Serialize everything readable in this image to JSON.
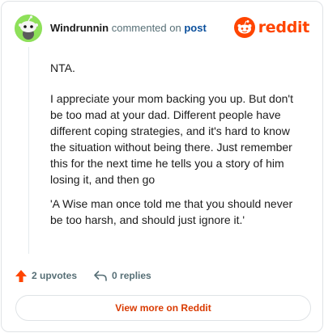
{
  "header": {
    "username": "Windrunnin",
    "action_text": "commented on",
    "post_link": "post",
    "brand": "reddit"
  },
  "comment": {
    "paragraphs": [
      "NTA.",
      "I appreciate your mom backing you up. But don't be too mad at your dad. Different people have different coping strategies, and it's hard to know the situation without being there. Just remember this for the next time he tells you a story of him losing it, and then go",
      "'A Wise man once told me that you should never be too harsh, and should just ignore it.'"
    ]
  },
  "actions": {
    "upvotes": "2 upvotes",
    "replies": "0 replies"
  },
  "footer": {
    "view_more": "View more on Reddit"
  },
  "colors": {
    "brand": "#ff4500",
    "link": "#0a4f9c",
    "upvote": "#ff4500",
    "view_more": "#d93a00",
    "avatar_bg": "#8ee05a"
  },
  "icons": {
    "avatar": "snoo-avatar-icon",
    "brand": "reddit-logo-icon",
    "upvote": "upvote-arrow-icon",
    "reply": "reply-arrow-icon"
  }
}
